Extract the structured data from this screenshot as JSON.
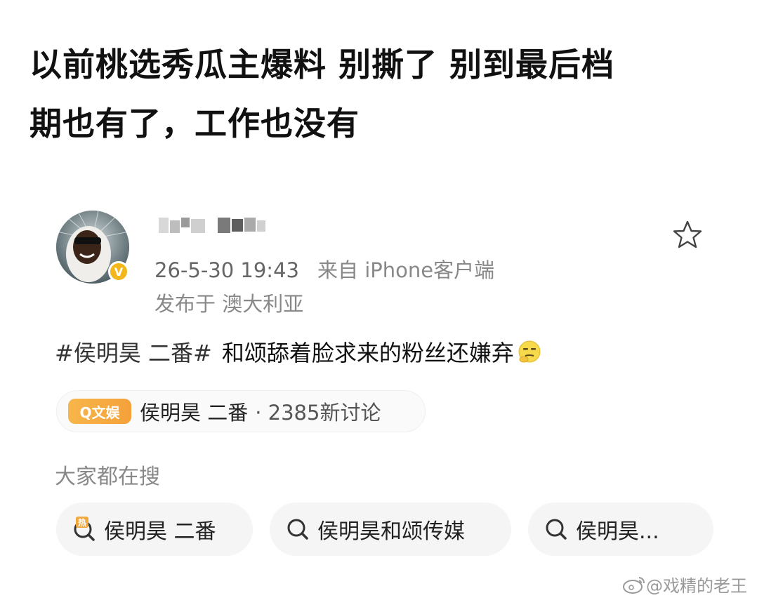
{
  "headline": {
    "line1": "以前桃选秀瓜主爆料 别撕了 别到最后档",
    "line2": "期也有了，工作也没有"
  },
  "post": {
    "timestamp": "26-5-30 19:43",
    "source": "来自 iPhone客户端",
    "location": "发布于 澳大利亚",
    "hashtag": "#侯明昊 二番#",
    "text": "和颂舔着脸求来的粉丝还嫌弃",
    "verified_badge": "V",
    "favorite_icon": "star-outline-icon"
  },
  "topic_chip": {
    "category": "Q文娱",
    "name": "侯明昊 二番",
    "count": "· 2385新讨论"
  },
  "search_section": {
    "label": "大家都在搜",
    "items": [
      {
        "text": "侯明昊 二番",
        "hot": "热"
      },
      {
        "text": "侯明昊和颂传媒"
      },
      {
        "text": "侯明昊..."
      }
    ]
  },
  "watermark": {
    "text": "@戏精的老王"
  },
  "colors": {
    "badge": "#f2b81b",
    "pill": "#f5a13a",
    "chip_bg": "#f5f5f5",
    "meta_text": "#888888"
  }
}
